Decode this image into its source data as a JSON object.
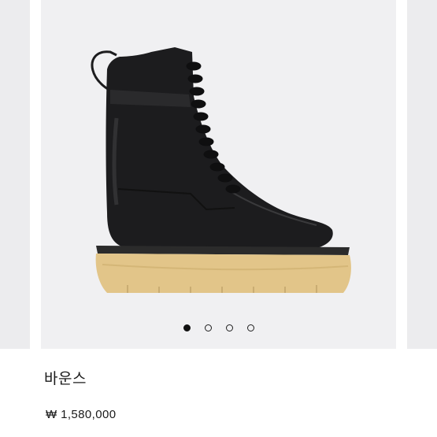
{
  "product": {
    "title": "바운스",
    "price": "₩ 1,580,000"
  },
  "carousel": {
    "slide_count": 4,
    "active_index": 0
  },
  "colors": {
    "boot_leather": "#1c1c1e",
    "boot_sole": "#e2c589",
    "slide_background": "#f0f0f2",
    "peek_background": "#ececee"
  }
}
